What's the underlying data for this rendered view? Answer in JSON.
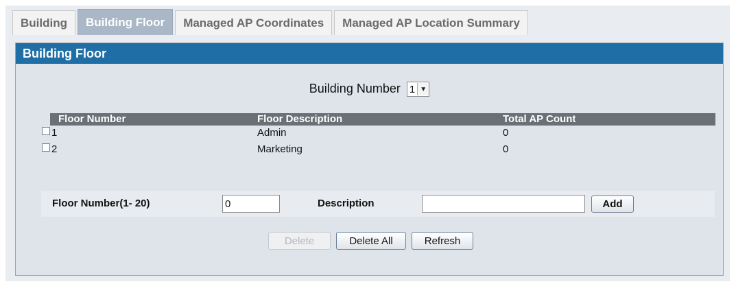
{
  "tabs": [
    {
      "label": "Building"
    },
    {
      "label": "Building Floor"
    },
    {
      "label": "Managed AP Coordinates"
    },
    {
      "label": "Managed AP Location Summary"
    }
  ],
  "panel": {
    "title": "Building Floor"
  },
  "building_number": {
    "label": "Building Number",
    "value": "1"
  },
  "table": {
    "headers": [
      "Floor Number",
      "Floor Description",
      "Total AP Count"
    ],
    "rows": [
      {
        "floor": "1",
        "description": "Admin",
        "count": "0"
      },
      {
        "floor": "2",
        "description": "Marketing",
        "count": "0"
      }
    ]
  },
  "form": {
    "floor_label": "Floor Number(1- 20)",
    "floor_value": "0",
    "description_label": "Description",
    "description_value": "",
    "add_label": "Add"
  },
  "buttons": {
    "delete": "Delete",
    "delete_all": "Delete All",
    "refresh": "Refresh"
  },
  "colors": {
    "header_blue": "#1f6ea6",
    "active_tab": "#a9b7c6",
    "table_header": "#6b7076"
  }
}
